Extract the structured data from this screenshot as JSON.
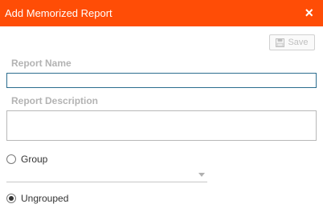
{
  "dialog": {
    "title": "Add Memorized Report",
    "close_icon": "×",
    "accent_color": "#ff4d06"
  },
  "toolbar": {
    "save_label": "Save",
    "save_icon": "floppy-disk-icon"
  },
  "form": {
    "report_name_label": "Report Name",
    "report_name_value": "",
    "report_description_label": "Report Description",
    "report_description_value": ""
  },
  "grouping": {
    "group_label": "Group",
    "group_selected": false,
    "group_select_value": "",
    "ungrouped_label": "Ungrouped",
    "ungrouped_selected": true
  }
}
